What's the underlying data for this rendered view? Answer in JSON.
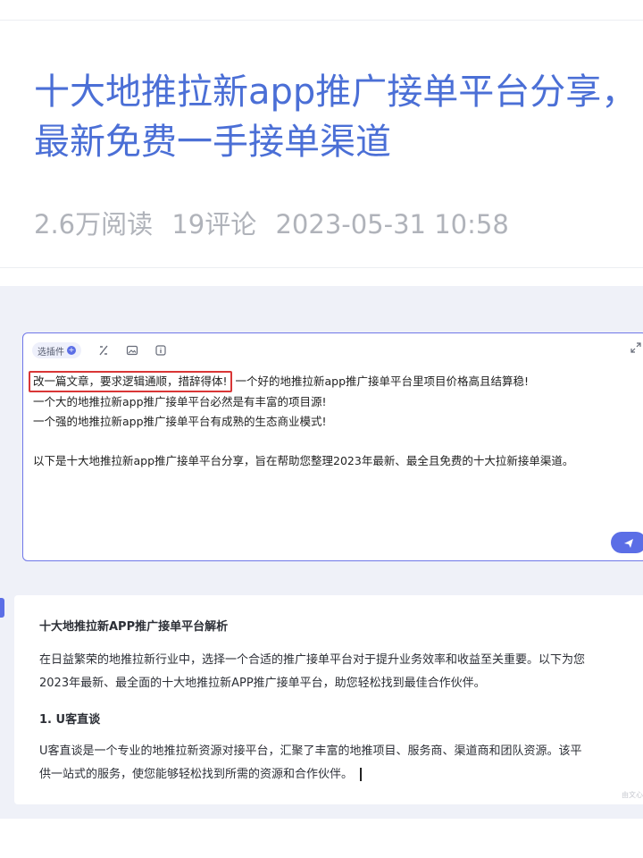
{
  "article": {
    "title_line1": "十大地推拉新app推广接单平台分享，",
    "title_line2": "最新免费一手接单渠道",
    "reads": "2.6万阅读",
    "comments": "19评论",
    "datetime": "2023-05-31 10:58"
  },
  "editor": {
    "plugin_label": "选插件",
    "plugin_badge": "+",
    "highlighted_prompt": "改一篇文章，要求逻辑通顺，措辞得体!",
    "line1_rest": "一个好的地推拉新app推广接单平台里项目价格高且结算稳!",
    "line2": "一个大的地推拉新app推广接单平台必然是有丰富的项目源!",
    "line3": "一个强的地推拉新app推广接单平台有成熟的生态商业模式!",
    "line4": "以下是十大地推拉新app推广接单平台分享，旨在帮助您整理2023年最新、最全且免费的十大拉新接单渠道。",
    "icons": [
      "format-icon",
      "image-icon",
      "info-icon",
      "expand-icon",
      "send-icon"
    ]
  },
  "result": {
    "heading": "十大地推拉新APP推广接单平台解析",
    "para1_line1": "在日益繁荣的地推拉新行业中，选择一个合适的推广接单平台对于提升业务效率和收益至关重要。以下为您",
    "para1_line2": "2023年最新、最全面的十大地推拉新APP推广接单平台，助您轻松找到最佳合作伙伴。",
    "sub1": "1. U客直谈",
    "para2_line1": "U客直谈是一个专业的地推拉新资源对接平台，汇聚了丰富的地推项目、服务商、渠道商和团队资源。该平",
    "para2_line2": "供一站式的服务，使您能够轻松找到所需的资源和合作伙伴。",
    "watermark": "由文心"
  },
  "colors": {
    "title_blue": "#4b6fd6",
    "accent": "#5b6ee6",
    "highlight_red": "#d93636",
    "panel_bg": "#eff1f8"
  }
}
